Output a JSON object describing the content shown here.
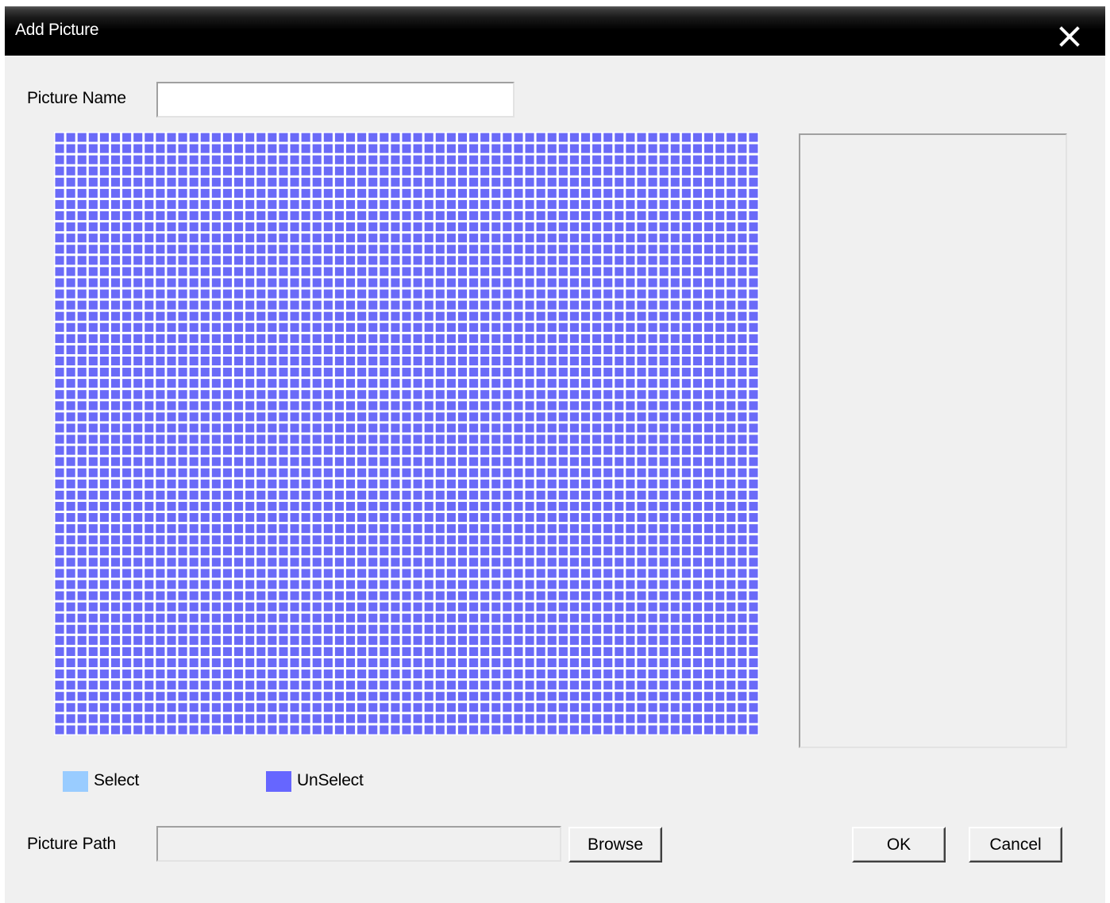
{
  "dialog": {
    "title": "Add Picture",
    "close_icon": "close-icon"
  },
  "form": {
    "picture_name_label": "Picture Name",
    "picture_name_value": "",
    "picture_path_label": "Picture Path",
    "picture_path_value": ""
  },
  "grid": {
    "columns": 63,
    "rows": 54,
    "cell_color": "#6a6af8",
    "background_color": "#ffffff"
  },
  "legend": {
    "select_label": "Select",
    "select_color": "#99ccff",
    "unselect_label": "UnSelect",
    "unselect_color": "#6666ff"
  },
  "buttons": {
    "browse_label": "Browse",
    "ok_label": "OK",
    "cancel_label": "Cancel"
  }
}
